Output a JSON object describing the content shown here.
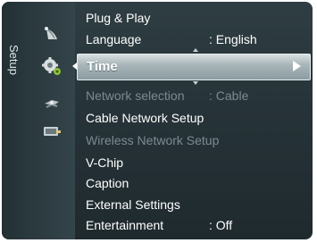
{
  "sidebar": {
    "label": "Setup"
  },
  "icons": [
    {
      "name": "satellite-dish-icon"
    },
    {
      "name": "gear-icon"
    },
    {
      "name": "network-icon"
    },
    {
      "name": "input-icon"
    }
  ],
  "menu": {
    "items": [
      {
        "label": "Plug & Play",
        "value": ""
      },
      {
        "label": "Language",
        "value": ": English"
      },
      {
        "label": "Time",
        "value": ""
      },
      {
        "label": "Network selection",
        "value": ": Cable"
      },
      {
        "label": "Cable Network Setup",
        "value": ""
      },
      {
        "label": "Wireless Network Setup",
        "value": ""
      },
      {
        "label": "V-Chip",
        "value": ""
      },
      {
        "label": "Caption",
        "value": ""
      },
      {
        "label": "External Settings",
        "value": ""
      },
      {
        "label": "Entertainment",
        "value": ": Off"
      }
    ]
  },
  "colors": {
    "panel_bg": "#263338",
    "selected_bg": "#a9b6ba",
    "dim_text": "#7e8a8e",
    "text": "#ffffff"
  }
}
